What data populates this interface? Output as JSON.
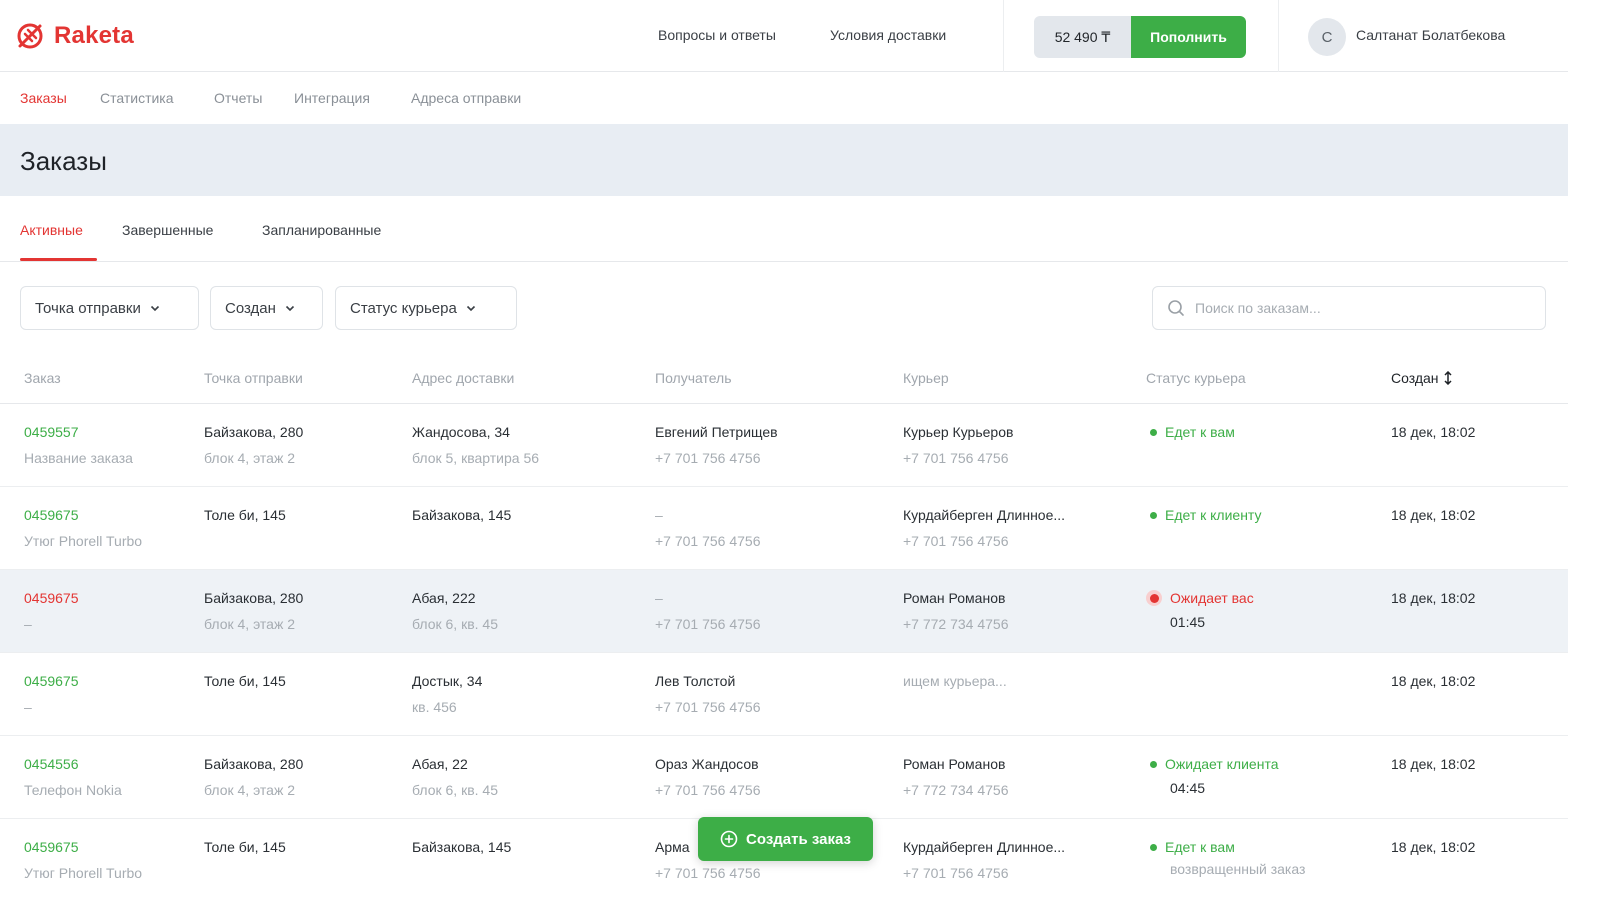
{
  "header": {
    "brand": "Raketa",
    "links": [
      "Вопросы и ответы",
      "Условия доставки"
    ],
    "balance": "52 490 ₸",
    "topup_label": "Пополнить",
    "avatar_initial": "С",
    "user_name": "Салтанат Болатбекова"
  },
  "subnav": [
    "Заказы",
    "Статистика",
    "Отчеты",
    "Интеграция",
    "Адреса отправки"
  ],
  "page_title": "Заказы",
  "tabs": [
    "Активные",
    "Завершенные",
    "Запланированные"
  ],
  "filters": [
    "Точка отправки",
    "Создан",
    "Статус курьера"
  ],
  "search": {
    "placeholder": "Поиск по заказам..."
  },
  "columns": [
    "Заказ",
    "Точка отправки",
    "Адрес доставки",
    "Получатель",
    "Курьер",
    "Статус курьера",
    "Создан"
  ],
  "rows": [
    {
      "id": "0459557",
      "name": "Название заказа",
      "from": "Байзакова, 280",
      "from_sub": "блок 4, этаж 2",
      "to": "Жандосова, 34",
      "to_sub": "блок 5, квартира 56",
      "recipient": "Евгений Петрищев",
      "recipient_phone": "+7 701 756 4756",
      "courier": "Курьер Курьеров",
      "courier_phone": "+7 701 756 4756",
      "status": "Едет к вам",
      "status_sub": "",
      "created": "18 дек, 18:02"
    },
    {
      "id": "0459675",
      "name": "Утюг Phorell Turbo",
      "from": "Толе би, 145",
      "from_sub": "",
      "to": "Байзакова, 145",
      "to_sub": "",
      "recipient": "–",
      "recipient_phone": "+7 701 756 4756",
      "courier": "Курдайберген Длинное...",
      "courier_phone": "+7 701 756 4756",
      "status": "Едет к клиенту",
      "status_sub": "",
      "created": "18 дек, 18:02"
    },
    {
      "id": "0459675",
      "name": "–",
      "from": "Байзакова, 280",
      "from_sub": "блок 4, этаж 2",
      "to": "Абая, 222",
      "to_sub": "блок 6, кв. 45",
      "recipient": "–",
      "recipient_phone": "+7 701 756 4756",
      "courier": "Роман Романов",
      "courier_phone": "+7 772 734 4756",
      "status": "Ожидает вас",
      "status_sub": "01:45",
      "created": "18 дек, 18:02"
    },
    {
      "id": "0459675",
      "name": "–",
      "from": "Толе би, 145",
      "from_sub": "",
      "to": "Достык, 34",
      "to_sub": "кв. 456",
      "recipient": "Лев Толстой",
      "recipient_phone": "+7 701 756 4756",
      "courier": "ищем курьера...",
      "courier_phone": "",
      "status": "",
      "status_sub": "",
      "created": "18 дек, 18:02"
    },
    {
      "id": "0454556",
      "name": "Телефон Nokia",
      "from": "Байзакова, 280",
      "from_sub": "блок 4, этаж 2",
      "to": "Абая, 22",
      "to_sub": "блок 6, кв. 45",
      "recipient": "Ораз Жандосов",
      "recipient_phone": "+7 701 756 4756",
      "courier": "Роман Романов",
      "courier_phone": "+7 772 734 4756",
      "status": "Ожидает клиента",
      "status_sub": "04:45",
      "created": "18 дек, 18:02"
    },
    {
      "id": "0459675",
      "name": "Утюг Phorell Turbo",
      "from": "Толе би, 145",
      "from_sub": "",
      "to": "Байзакова, 145",
      "to_sub": "",
      "recipient": "Арма",
      "recipient_phone": "+7 701 756 4756",
      "courier": "Курдайберген Длинное...",
      "courier_phone": "+7 701 756 4756",
      "status": "Едет к вам",
      "status_sub": "возвращенный заказ",
      "created": "18 дек, 18:02"
    }
  ],
  "fab_label": "Создать заказ",
  "colors": {
    "brand": "#e33533",
    "accent": "#3dae47",
    "highlight_row": "#eef2f6"
  }
}
